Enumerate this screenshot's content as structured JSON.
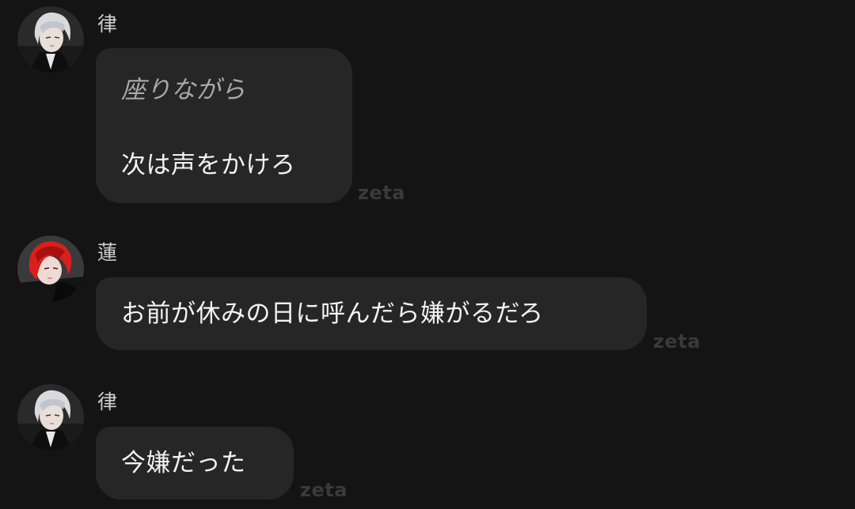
{
  "messages": [
    {
      "sender": "律",
      "avatar_icon": "white-haired-character-avatar",
      "action_text": "座りながら",
      "text": "次は声をかけろ",
      "watermark": "zeta"
    },
    {
      "sender": "蓮",
      "avatar_icon": "red-haired-character-avatar",
      "text": "お前が休みの日に呼んだら嫌がるだろ",
      "watermark": "zeta"
    },
    {
      "sender": "律",
      "avatar_icon": "white-haired-character-avatar",
      "text": "今嫌だった",
      "watermark": "zeta"
    }
  ],
  "colors": {
    "background": "#141414",
    "bubble": "#262626",
    "text": "#f2f2f2",
    "action_text": "#a9a9a9",
    "watermark": "#3a3a3a"
  }
}
